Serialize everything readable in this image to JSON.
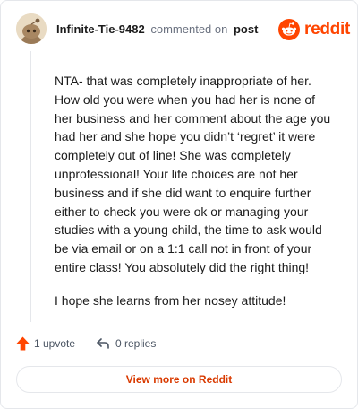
{
  "comment": {
    "author": "Infinite-Tie-9482",
    "action_text": "commented on",
    "post_link_label": "post",
    "paragraphs": [
      "NTA- that was completely inappropriate of her. How old you were when you had her is none of her business and her comment about the age you had her and she hope you didn’t ‘regret’ it were completely out of line! She was completely unprofessional! Your life choices are not her business and if she did want to enquire further either to check you were ok or managing your studies with a young child, the time to ask would be via email or on a 1:1 call not in front of your entire class! You absolutely did the right thing!",
      "I hope she learns from her nosey attitude!"
    ],
    "upvotes_label": "1 upvote",
    "replies_label": "0 replies"
  },
  "brand": {
    "name": "reddit",
    "icon": "reddit-snoo-logo",
    "color": "#ff4500"
  },
  "avatar_icon": "snoo-avatar",
  "icons": {
    "upvote": "upvote-arrow-icon",
    "reply": "reply-arrow-icon"
  },
  "colors": {
    "accent": "#ff4500",
    "link": "#d93a00",
    "border": "#e5e7eb"
  },
  "view_more_label": "View more on Reddit"
}
